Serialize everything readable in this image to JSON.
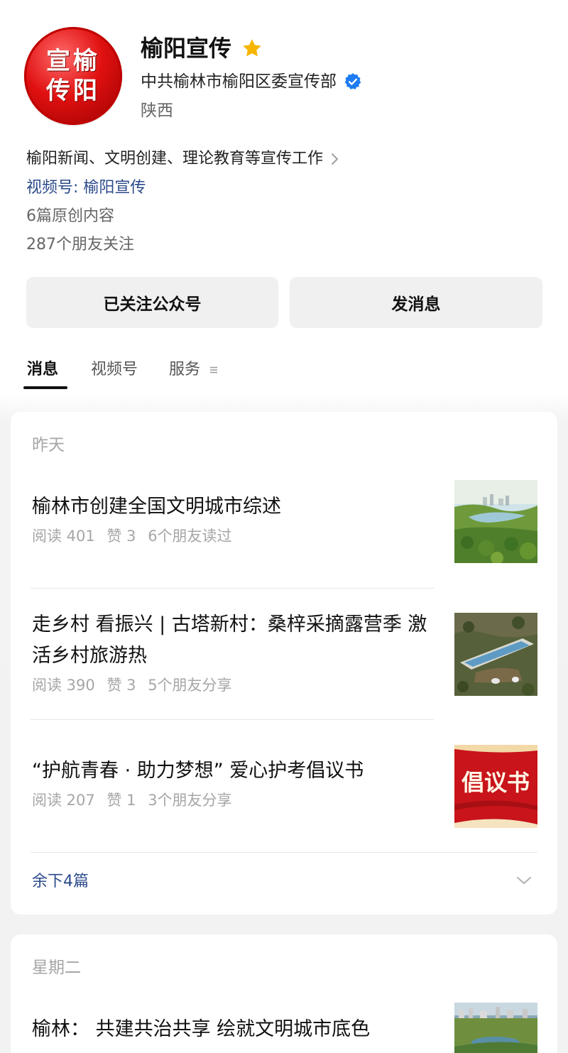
{
  "profile": {
    "avatar_text_top": "宣榆",
    "avatar_text_bottom": "传阳",
    "name": "榆阳宣传",
    "organization": "中共榆林市榆阳区委宣传部",
    "region": "陕西",
    "intro": "榆阳新闻、文明创建、理论教育等宣传工作",
    "channel": "视频号: 榆阳宣传",
    "original_count": "6篇原创内容",
    "friends_following": "287个朋友关注",
    "icons": {
      "star": "star-icon",
      "verified": "verified-icon",
      "intro_more": "chevron-right-icon"
    },
    "colors": {
      "star": "#F7B500",
      "verified": "#1E7CF2",
      "link": "#2B4A8A"
    }
  },
  "actions": {
    "follow_label": "已关注公众号",
    "message_label": "发消息"
  },
  "tabs": [
    {
      "label": "消息",
      "active": true
    },
    {
      "label": "视频号",
      "active": false
    },
    {
      "label": "服务",
      "active": false,
      "icon": "menu-icon"
    }
  ],
  "feed": {
    "groups": [
      {
        "day": "昨天",
        "articles": [
          {
            "title": "榆林市创建全国文明城市综述",
            "reads": "阅读 401",
            "likes": "赞 3",
            "friends": "6个朋友读过",
            "thumb": "park-landscape-image"
          },
          {
            "title": "走乡村 看振兴 | 古塔新村：桑梓采摘露营季 激活乡村旅游热",
            "reads": "阅读 390",
            "likes": "赞 3",
            "friends": "5个朋友分享",
            "thumb": "village-pool-aerial-image"
          },
          {
            "title": "“护航青春 · 助力梦想” 爱心护考倡议书",
            "reads": "阅读 207",
            "likes": "赞 1",
            "friends": "3个朋友分享",
            "thumb": "proposal-banner-image",
            "thumb_text": "倡议书"
          }
        ],
        "more_label": "余下4篇",
        "more_icon": "chevron-down-icon"
      },
      {
        "day": "星期二",
        "articles": [
          {
            "title": "榆林： 共建共治共享 绘就文明城市底色",
            "thumb": "city-aerial-image"
          }
        ]
      }
    ]
  }
}
